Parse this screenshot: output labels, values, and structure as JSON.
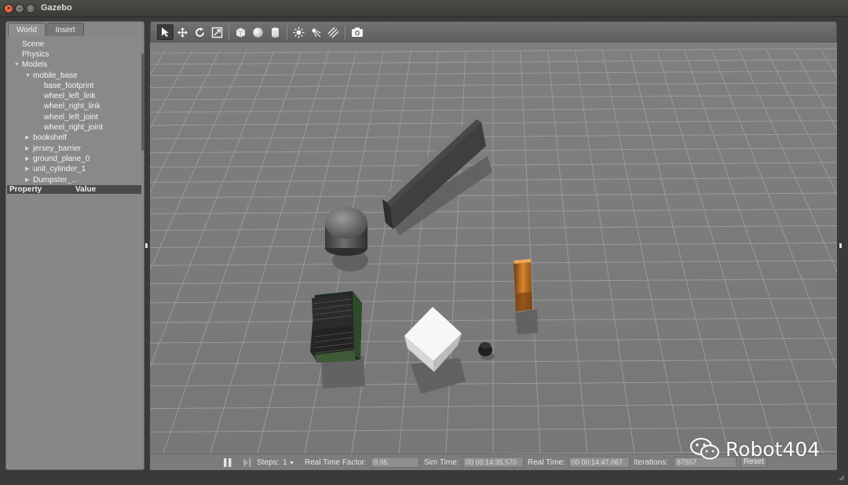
{
  "window": {
    "title": "Gazebo",
    "close_glyph": "×",
    "min_glyph": "–",
    "max_glyph": "□"
  },
  "left_panel": {
    "tabs": [
      {
        "label": "World",
        "active": true
      },
      {
        "label": "Insert",
        "active": false
      }
    ],
    "tree": {
      "scene": "Scene",
      "physics": "Physics",
      "models": "Models",
      "mobile_base": "mobile_base",
      "base_footprint": "base_footprint",
      "wheel_left_link": "wheel_left_link",
      "wheel_right_link": "wheel_right_link",
      "wheel_left_joint": "wheel_left_joint",
      "wheel_right_joint": "wheel_right_joint",
      "bookshelf": "bookshelf",
      "jersey_barrier": "jersey_barrier",
      "ground_plane_0": "ground_plane_0",
      "unit_cylinder_1": "unit_cylinder_1",
      "dumpster_partial": "Dumpster_..."
    },
    "property_header": {
      "property": "Property",
      "value": "Value"
    }
  },
  "toolbar": {
    "tools": [
      "select-arrow-icon",
      "translate-icon",
      "rotate-icon",
      "scale-icon",
      "box-icon",
      "sphere-icon",
      "cylinder-icon",
      "point-light-icon",
      "spot-light-icon",
      "directional-light-icon",
      "screenshot-icon"
    ]
  },
  "bottom_bar": {
    "steps_label": "Steps:",
    "steps_value": "1",
    "rtf_label": "Real Time Factor:",
    "rtf_value": "0.95",
    "sim_time_label": "Sim Time:",
    "sim_time_value": "00 00:14:35.570",
    "real_time_label": "Real Time:",
    "real_time_value": "00 00:14:47.067",
    "iterations_label": "Iterations:",
    "iterations_value": "87557",
    "reset_label": "Reset"
  },
  "watermark": {
    "text": "Robot404"
  },
  "colors": {
    "viewport_bg": "#7b7b7b",
    "grid_line": "#9a9a9a",
    "panel_bg": "#878787",
    "accent_close": "#e0481f"
  }
}
